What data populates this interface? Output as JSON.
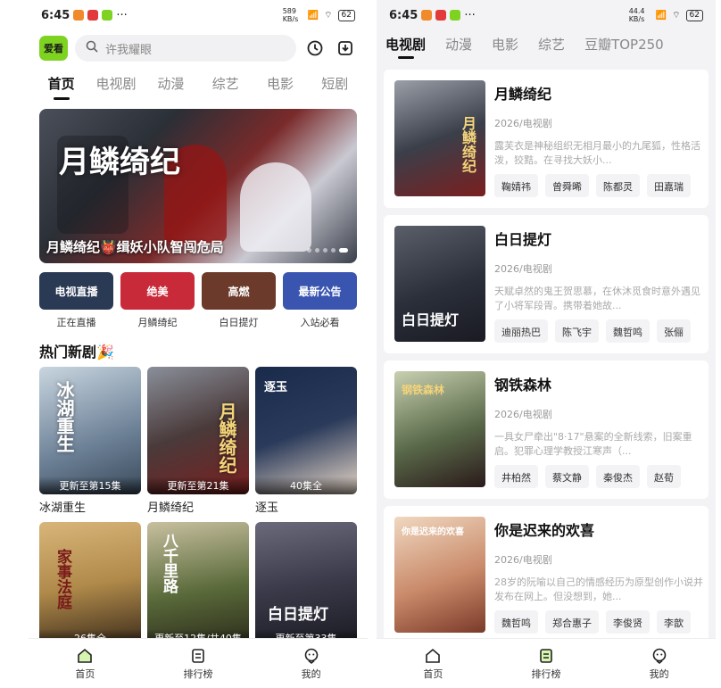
{
  "status_left": {
    "time": "6:45",
    "dots": "···",
    "speed": "589 KB/s",
    "battery": "62"
  },
  "status_right": {
    "time": "6:45",
    "dots": "···",
    "speed": "44.4 KB/s",
    "battery": "62"
  },
  "left": {
    "logo": "爱看",
    "search_placeholder": "许我耀眼",
    "tabs": [
      "首页",
      "电视剧",
      "动漫",
      "综艺",
      "电影",
      "短剧"
    ],
    "banner": {
      "calligraphy": "月鳞绮纪",
      "caption": "月鳞绮纪👹缉妖小队智闯危局"
    },
    "shortcuts": [
      {
        "label": "正在直播",
        "image_text": "电视直播",
        "color": "#2a3a55"
      },
      {
        "label": "月鳞绮纪",
        "image_text": "绝美",
        "color": "#c92a3a"
      },
      {
        "label": "白日提灯",
        "image_text": "高燃",
        "color": "#6b3a2a"
      },
      {
        "label": "入站必看",
        "image_text": "最新公告",
        "color": "#3a55b0"
      }
    ],
    "section_title": "热门新剧🎉",
    "shows_row1": [
      {
        "title": "冰湖重生",
        "tag": "更新至第15集",
        "art": "冰湖重生",
        "color": "#6b7f95"
      },
      {
        "title": "月鳞绮纪",
        "tag": "更新至第21集",
        "art": "月鳞绮纪",
        "color": "#4a3a3a"
      },
      {
        "title": "逐玉",
        "tag": "40集全",
        "art": "逐玉",
        "color": "#2a3a5a"
      }
    ],
    "shows_row2": [
      {
        "tag": "26集全",
        "art": "家事法庭",
        "color": "#b08a4a"
      },
      {
        "tag": "更新至12集/共40集",
        "art": "八千里路",
        "color": "#5a6a3a"
      },
      {
        "tag": "更新至第33集",
        "art": "白日提灯",
        "color": "#3a3a4a"
      }
    ],
    "nav": [
      "首页",
      "排行榜",
      "我的"
    ]
  },
  "right": {
    "tabs": [
      "电视剧",
      "动漫",
      "电影",
      "综艺",
      "豆瓣TOP250"
    ],
    "items": [
      {
        "title": "月鳞绮纪",
        "meta": "2026/电视剧",
        "desc": "露芙衣是神秘组织无相月最小的九尾狐，性格活泼，狡黠。在寻找大妖小...",
        "cast": [
          "鞠婧祎",
          "曾舜晞",
          "陈都灵",
          "田嘉瑞"
        ],
        "art": "月鳞绮纪",
        "color": "#3a3f4a"
      },
      {
        "title": "白日提灯",
        "meta": "2026/电视剧",
        "desc": "天赋卓然的鬼王贺思慕，在休沐觅食时意外遇见了小将军段胥。携带着她故...",
        "cast": [
          "迪丽热巴",
          "陈飞宇",
          "魏哲鸣",
          "张俪"
        ],
        "art": "白日提灯",
        "color": "#2a2f3a"
      },
      {
        "title": "钢铁森林",
        "meta": "2026/电视剧",
        "desc": "一具女尸牵出\"8·17\"悬案的全新线索，旧案重启。犯罪心理学教授江寒声（...",
        "cast": [
          "井柏然",
          "蔡文静",
          "秦俊杰",
          "赵荀"
        ],
        "art": "钢铁森林",
        "color": "#5a6a4a"
      },
      {
        "title": "你是迟来的欢喜",
        "meta": "2026/电视剧",
        "desc": "28岁的阮喻以自己的情感经历为原型创作小说并发布在网上。但没想到，她...",
        "cast": [
          "魏哲鸣",
          "郑合惠子",
          "李俊贤",
          "李歆"
        ],
        "art": "你是迟来的欢喜",
        "color": "#c98a6a"
      }
    ],
    "nav": [
      "首页",
      "排行榜",
      "我的"
    ]
  },
  "colors": {
    "accent": "#7ed321",
    "text": "#111111",
    "muted": "#888888"
  }
}
